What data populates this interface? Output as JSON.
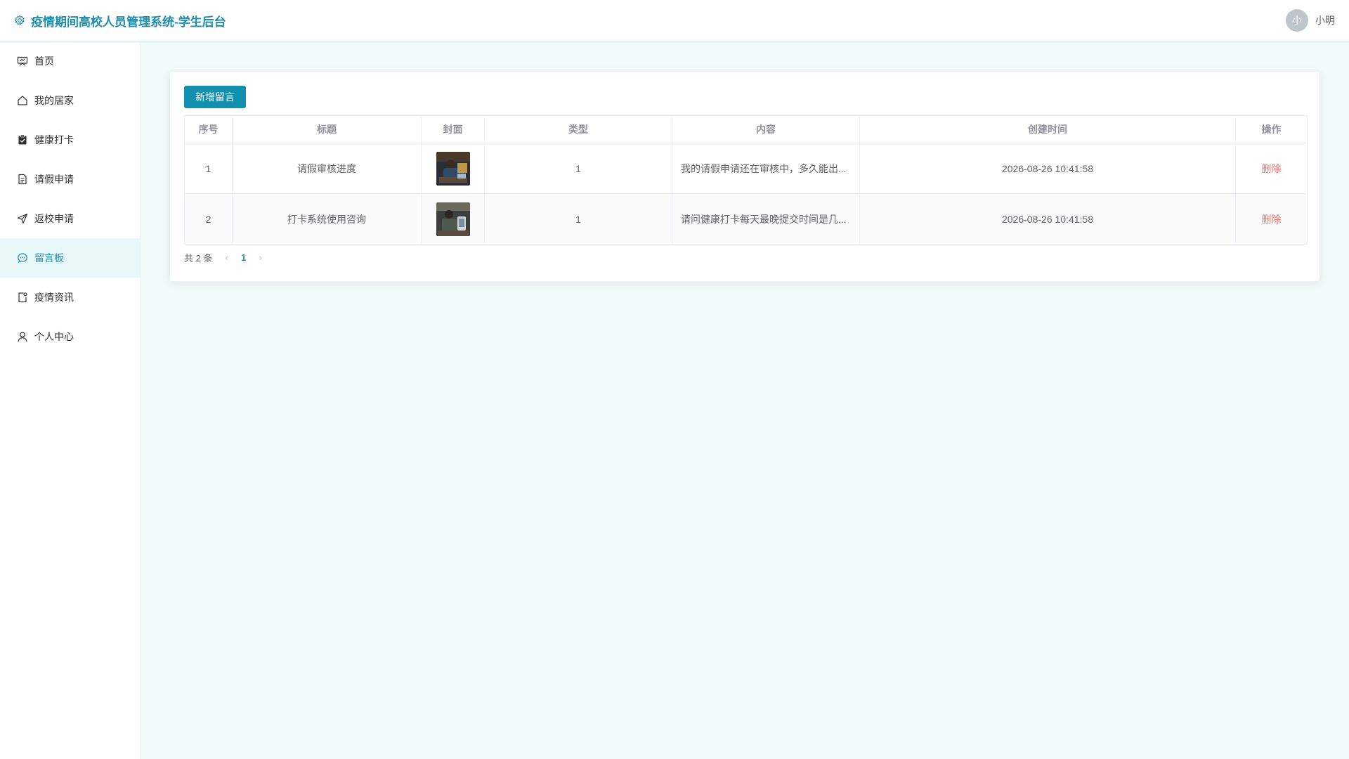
{
  "header": {
    "title": "疫情期间高校人员管理系统-学生后台",
    "avatar_text": "小",
    "user_name": "小明"
  },
  "sidebar": {
    "items": [
      {
        "label": "首页",
        "icon": "monitor-icon"
      },
      {
        "label": "我的居家",
        "icon": "house-icon"
      },
      {
        "label": "健康打卡",
        "icon": "clipboard-check-icon"
      },
      {
        "label": "请假申请",
        "icon": "document-icon"
      },
      {
        "label": "返校申请",
        "icon": "send-icon"
      },
      {
        "label": "留言板",
        "icon": "chat-icon",
        "active": true
      },
      {
        "label": "疫情资讯",
        "icon": "news-icon"
      },
      {
        "label": "个人中心",
        "icon": "user-icon"
      }
    ]
  },
  "main": {
    "add_button": "新增留言",
    "table": {
      "columns": [
        "序号",
        "标题",
        "封面",
        "类型",
        "内容",
        "创建时间",
        "操作"
      ],
      "rows": [
        {
          "index": "1",
          "title": "请假审核进度",
          "cover": "cover-image",
          "type": "1",
          "content": "我的请假申请还在审核中，多久能出...",
          "created": "2026-08-26 10:41:58",
          "action": "删除"
        },
        {
          "index": "2",
          "title": "打卡系统使用咨询",
          "cover": "cover-image",
          "type": "1",
          "content": "请问健康打卡每天最晚提交时间是几...",
          "created": "2026-08-26 10:41:58",
          "action": "删除"
        }
      ]
    },
    "pagination": {
      "total": "共 2 条",
      "current_page": "1",
      "prev": "‹",
      "next": "›"
    }
  },
  "colors": {
    "brand": "#1b8eae",
    "button": "#138fb0",
    "page_bg": "#f0fbfa",
    "danger": "#f56c6c"
  }
}
